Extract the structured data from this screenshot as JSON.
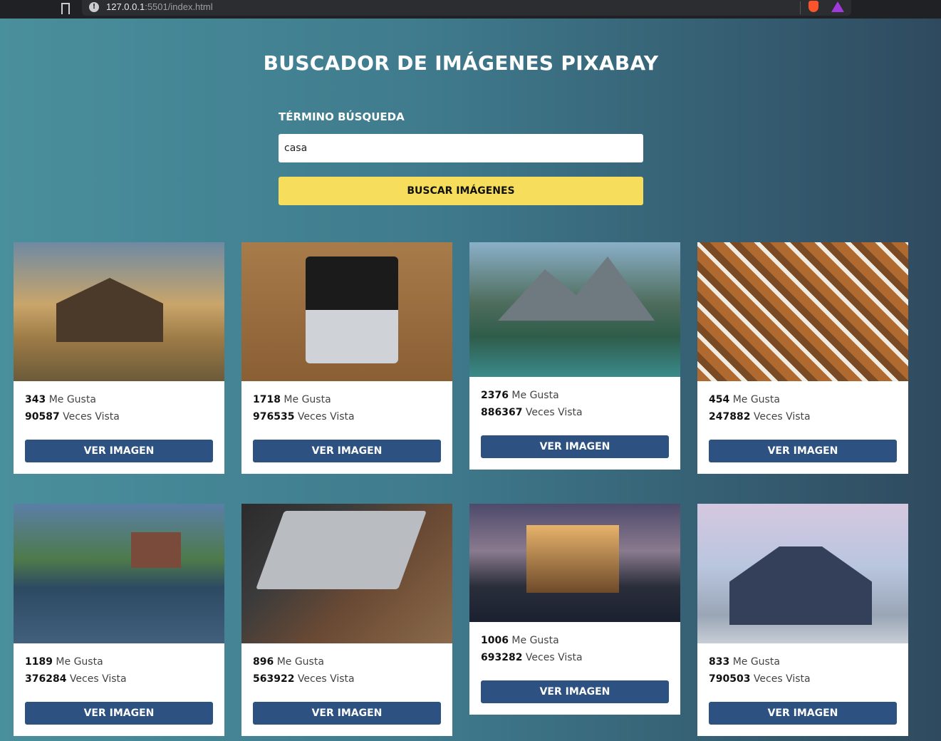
{
  "browser": {
    "url_host": "127.0.0.1",
    "url_rest": ":5501/index.html"
  },
  "header": {
    "title": "BUSCADOR DE IMÁGENES PIXABAY"
  },
  "search": {
    "label": "TÉRMINO BÚSQUEDA",
    "value": "casa",
    "button_label": "BUSCAR IMÁGENES"
  },
  "colors": {
    "accent_button": "#f6dd5b",
    "card_button": "#2d5282"
  },
  "cards": [
    {
      "likes": "343",
      "likes_label": "Me Gusta",
      "views": "90587",
      "views_label": "Veces Vista",
      "button": "VER IMAGEN",
      "image": "old-wooden-cabin"
    },
    {
      "likes": "1718",
      "likes_label": "Me Gusta",
      "views": "976535",
      "views_label": "Veces Vista",
      "button": "VER IMAGEN",
      "image": "laptop-on-desk"
    },
    {
      "likes": "2376",
      "likes_label": "Me Gusta",
      "views": "886367",
      "views_label": "Veces Vista",
      "button": "VER IMAGEN",
      "image": "mountain-lake-house"
    },
    {
      "likes": "454",
      "likes_label": "Me Gusta",
      "views": "247882",
      "views_label": "Veces Vista",
      "button": "VER IMAGEN",
      "image": "timber-frame-village"
    },
    {
      "likes": "1189",
      "likes_label": "Me Gusta",
      "views": "376284",
      "views_label": "Veces Vista",
      "button": "VER IMAGEN",
      "image": "lakeside-boathouse"
    },
    {
      "likes": "896",
      "likes_label": "Me Gusta",
      "views": "563922",
      "views_label": "Veces Vista",
      "button": "VER IMAGEN",
      "image": "laptop-and-notepad"
    },
    {
      "likes": "1006",
      "likes_label": "Me Gusta",
      "views": "693282",
      "views_label": "Veces Vista",
      "button": "VER IMAGEN",
      "image": "modern-house-night"
    },
    {
      "likes": "833",
      "likes_label": "Me Gusta",
      "views": "790503",
      "views_label": "Veces Vista",
      "button": "VER IMAGEN",
      "image": "suburban-house"
    }
  ]
}
